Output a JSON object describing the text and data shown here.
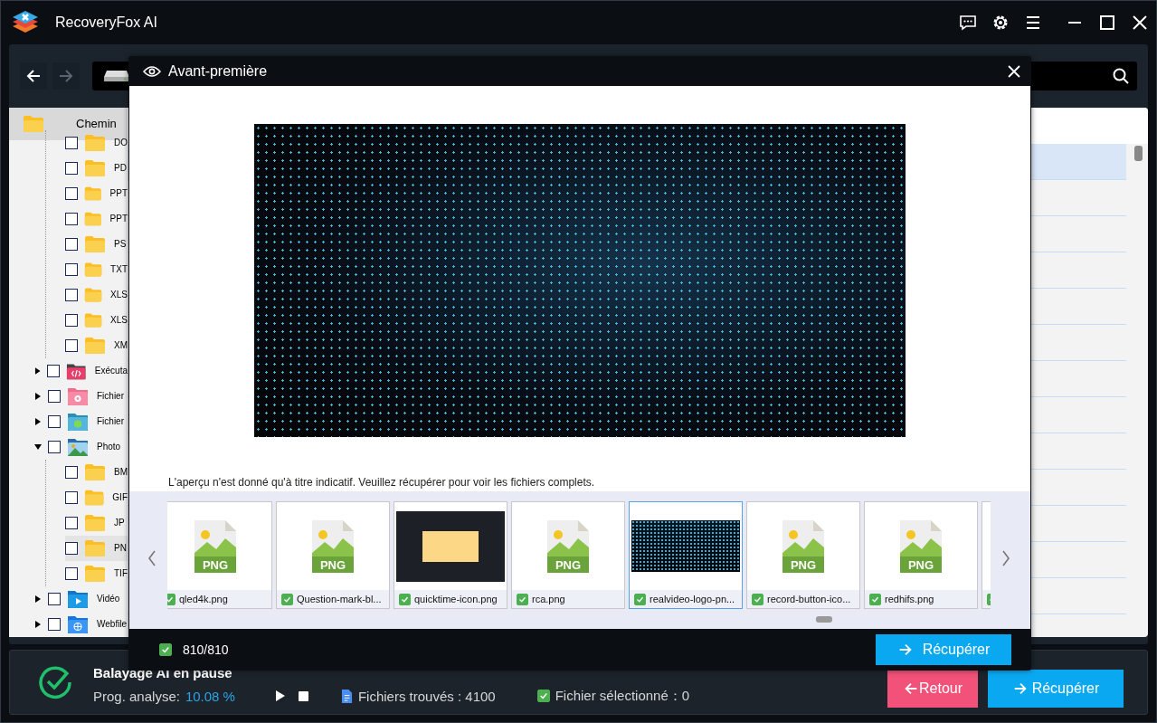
{
  "window": {
    "title": "RecoveryFox AI"
  },
  "toolbar": {
    "back_disabled": false,
    "forward_disabled": true
  },
  "tree": {
    "header": "Chemin",
    "nodes": [
      {
        "children": [
          {
            "label": "DO",
            "checked": false,
            "selected": false
          },
          {
            "label": "PD",
            "checked": false,
            "selected": false
          },
          {
            "label": "PPT",
            "checked": false,
            "selected": false
          },
          {
            "label": "PPT",
            "checked": false,
            "selected": false
          },
          {
            "label": "PS",
            "checked": false,
            "selected": false
          },
          {
            "label": "TXT",
            "checked": false,
            "selected": false
          },
          {
            "label": "XLS",
            "checked": false,
            "selected": false
          },
          {
            "label": "XLS",
            "checked": false,
            "selected": false
          },
          {
            "label": "XM",
            "checked": false,
            "selected": false
          }
        ]
      },
      {
        "label": "Exécuta",
        "kind": "code",
        "checked": false,
        "expanded": false
      },
      {
        "label": "Fichier",
        "kind": "settings",
        "checked": false,
        "expanded": false
      },
      {
        "label": "Fichier",
        "kind": "cube",
        "checked": false,
        "expanded": false
      },
      {
        "label": "Photo",
        "kind": "photo",
        "checked": false,
        "expanded": true,
        "children": [
          {
            "label": "BM",
            "checked": false,
            "selected": false
          },
          {
            "label": "GIF",
            "checked": false,
            "selected": false
          },
          {
            "label": "JP",
            "checked": false,
            "selected": false
          },
          {
            "label": "PN",
            "checked": false,
            "selected": true
          },
          {
            "label": "TIF",
            "checked": false,
            "selected": false
          }
        ]
      },
      {
        "label": "Vidéo",
        "kind": "video",
        "checked": false,
        "expanded": false
      },
      {
        "label": "Webfile",
        "kind": "web",
        "checked": false,
        "expanded": false
      }
    ]
  },
  "file_list": {
    "rows": [
      {
        "selected": true
      },
      {
        "selected": false
      },
      {
        "selected": false
      },
      {
        "selected": false
      },
      {
        "selected": false
      },
      {
        "selected": false
      },
      {
        "selected": false
      },
      {
        "selected": false
      },
      {
        "selected": false
      },
      {
        "selected": false
      },
      {
        "selected": false
      },
      {
        "selected": false
      },
      {
        "selected": false
      }
    ]
  },
  "preview": {
    "title": "Avant-première",
    "note": "L'aperçu n'est donné qu'à titre indicatif. Veuillez récupérer pour voir les fichiers complets.",
    "thumbnails": [
      {
        "kind": "png",
        "badge": "PNG",
        "label": "qled4k.png",
        "checked": true,
        "selected": false
      },
      {
        "kind": "png",
        "badge": "PNG",
        "label": "Question-mark-bl...",
        "checked": true,
        "selected": false
      },
      {
        "kind": "screenshot",
        "label": "quicktime-icon.png",
        "checked": true,
        "selected": false
      },
      {
        "kind": "png",
        "badge": "PNG",
        "label": "rca.png",
        "checked": true,
        "selected": false
      },
      {
        "kind": "dark",
        "label": "realvideo-logo-pn...",
        "checked": true,
        "selected": true
      },
      {
        "kind": "png",
        "badge": "PNG",
        "label": "record-button-ico...",
        "checked": true,
        "selected": false
      },
      {
        "kind": "png",
        "badge": "PNG",
        "label": "redhifs.png",
        "checked": true,
        "selected": false
      },
      {
        "kind": "blank",
        "checked": true,
        "selected": false
      }
    ],
    "footer": {
      "checked": true,
      "count": "810/810",
      "button": "Récupérer"
    }
  },
  "status": {
    "title": "Balayage AI en pause",
    "progress_label": "Prog. analyse:",
    "progress_value": "10.08 %",
    "found": "Fichiers trouvés : 4100",
    "selected_checked": true,
    "selected": "Fichier sélectionné：0",
    "back_button": "Retour",
    "recover_button": "Récupérer"
  }
}
